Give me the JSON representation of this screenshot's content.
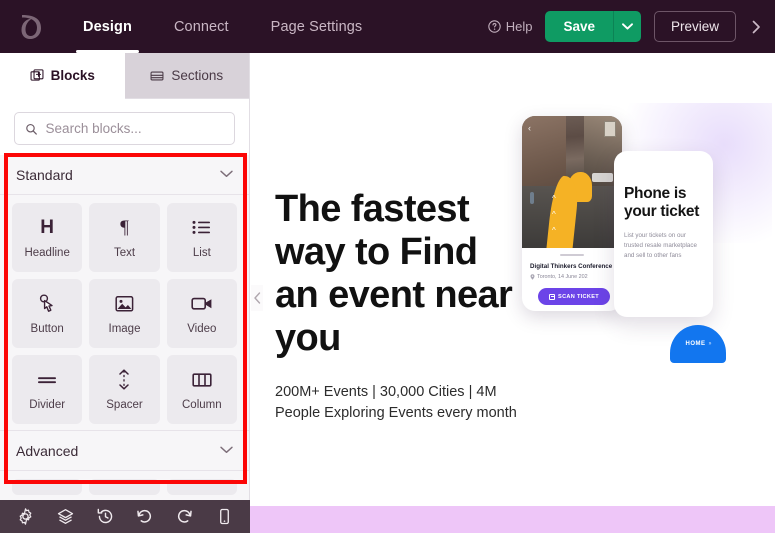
{
  "topbar": {
    "logo_icon": "leaf-logo-icon",
    "nav": [
      {
        "label": "Design",
        "active": true
      },
      {
        "label": "Connect",
        "active": false
      },
      {
        "label": "Page Settings",
        "active": false
      }
    ],
    "help_label": "Help",
    "help_icon": "question-circle-icon",
    "save_label": "Save",
    "save_caret_icon": "chevron-down-icon",
    "preview_label": "Preview",
    "expand_icon": "chevron-right-icon",
    "colors": {
      "background": "#2b1226",
      "save_green": "#0f9b63",
      "active_text": "#ffffff"
    }
  },
  "sidebar": {
    "tabs": [
      {
        "label": "Blocks",
        "icon": "blocks-grid-icon",
        "active": true
      },
      {
        "label": "Sections",
        "icon": "sections-rows-icon",
        "active": false
      }
    ],
    "search": {
      "placeholder": "Search blocks...",
      "value": "",
      "icon": "search-icon"
    },
    "groups": [
      {
        "title": "Standard",
        "chevron": "chevron-down-icon",
        "expanded": true,
        "tiles": [
          {
            "label": "Headline",
            "icon": "headline-h-icon",
            "glyph": "H"
          },
          {
            "label": "Text",
            "icon": "text-pilcrow-icon",
            "glyph": "¶"
          },
          {
            "label": "List",
            "icon": "list-icon",
            "glyph": ""
          },
          {
            "label": "Button",
            "icon": "button-click-icon",
            "glyph": ""
          },
          {
            "label": "Image",
            "icon": "image-icon",
            "glyph": ""
          },
          {
            "label": "Video",
            "icon": "video-camera-icon",
            "glyph": ""
          },
          {
            "label": "Divider",
            "icon": "divider-icon",
            "glyph": ""
          },
          {
            "label": "Spacer",
            "icon": "spacer-arrows-icon",
            "glyph": ""
          },
          {
            "label": "Column",
            "icon": "column-icon",
            "glyph": ""
          }
        ]
      },
      {
        "title": "Advanced",
        "chevron": "chevron-down-icon",
        "expanded": true,
        "tiles": []
      }
    ],
    "annotation": {
      "type": "red-highlight-box",
      "color": "#fc0606"
    }
  },
  "bottom_toolbar": {
    "items": [
      {
        "icon": "gear-settings-icon",
        "label": "Settings"
      },
      {
        "icon": "layers-icon",
        "label": "Layers"
      },
      {
        "icon": "revision-history-icon",
        "label": "Revision history"
      },
      {
        "icon": "undo-icon",
        "label": "Undo"
      },
      {
        "icon": "redo-icon",
        "label": "Redo"
      },
      {
        "icon": "mobile-device-icon",
        "label": "Responsive"
      }
    ]
  },
  "canvas": {
    "collapse_handle_icon": "chevron-left-icon",
    "hero": {
      "title": "The fastest way to Find an event near you",
      "subtitle": "200M+ Events | 30,000 Cities | 4M People Exploring Events every month",
      "art": {
        "phone_card": {
          "back_icon": "chevron-left-icon",
          "event_title": "Digital Thinkers Conference",
          "event_location_icon": "location-pin-icon",
          "event_location": "Toronto, 14 June 202",
          "scan_button_label": "SCAN TICKET",
          "scan_button_icon": "scan-square-icon",
          "scan_button_color": "#6c44e8"
        },
        "info_card": {
          "title": "Phone is your ticket",
          "body": "List your tickets on our trusted resale marketplace and sell to other fans"
        },
        "home_badge": {
          "label": "HOME",
          "chevrons": "››",
          "color": "#1276ef"
        }
      }
    },
    "bottom_band_color": "#eec6f8"
  }
}
